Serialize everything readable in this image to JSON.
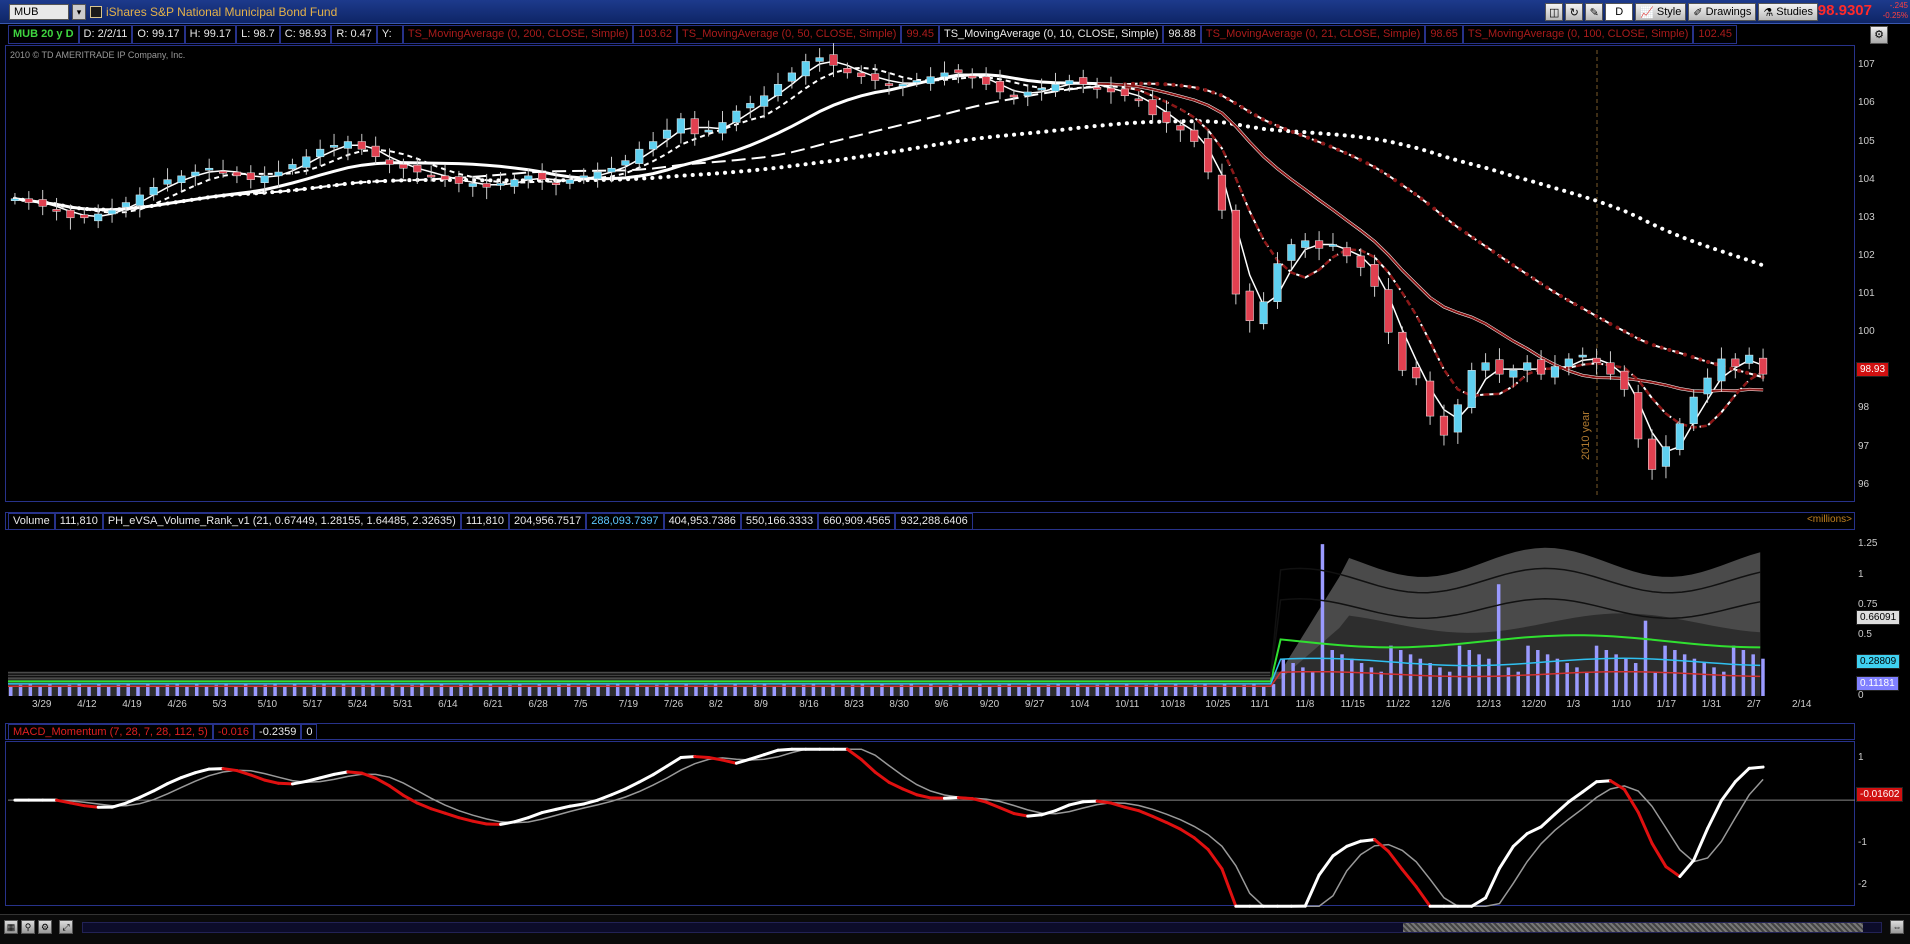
{
  "window": {
    "symbol": "MUB",
    "description": "iShares S&P National Municipal Bond Fund",
    "last_price": "98.9307",
    "change_1": "-.245",
    "change_2": "-0.25%",
    "buttons": {
      "period_label": "D",
      "style_label": "Style",
      "drawings_label": "Drawings",
      "studies_label": "Studies"
    }
  },
  "info": {
    "aggregation": "MUB 20 y D",
    "date": "D: 2/2/11",
    "open": "O: 99.17",
    "high": "H: 99.17",
    "low": "L: 98.7",
    "close": "C: 98.93",
    "range": "R: 0.47",
    "y": "Y:",
    "studies": [
      {
        "label": "TS_MovingAverage (0, 200, CLOSE, Simple)",
        "value": "103.62",
        "color": "red"
      },
      {
        "label": "TS_MovingAverage (0, 50, CLOSE, Simple)",
        "value": "99.45",
        "color": "red"
      },
      {
        "label": "TS_MovingAverage (0, 10, CLOSE, Simple)",
        "value": "98.88",
        "color": "white"
      },
      {
        "label": "TS_MovingAverage (0, 21, CLOSE, Simple)",
        "value": "98.65",
        "color": "red"
      },
      {
        "label": "TS_MovingAverage (0, 100, CLOSE, Simple)",
        "value": "102.45",
        "color": "red"
      }
    ]
  },
  "copyright": "2010 © TD AMERITRADE IP Company, Inc.",
  "price_axis": [
    "107",
    "106",
    "105",
    "104",
    "103",
    "102",
    "101",
    "100",
    "99",
    "98",
    "97",
    "96"
  ],
  "price_tag": "98.93",
  "year_marker": "2010 year",
  "volume": {
    "label": "Volume",
    "value": "111,810",
    "study_name": "PH_eVSA_Volume_Rank_v1 (21, 0.67449, 1.28155, 1.64485, 2.32635)",
    "study_values": [
      "111,810",
      "204,956.7517",
      "288,093.7397",
      "404,953.7386",
      "550,166.3333",
      "660,909.4565",
      "932,288.6406"
    ],
    "units": "<millions>",
    "axis": [
      "1.25",
      "1",
      "0.75",
      "0.5",
      "0.25",
      "0"
    ],
    "tags": {
      "gray": "0.66091",
      "cyan": "0.28809",
      "blue": "0.11181"
    }
  },
  "dates": [
    "3/29",
    "4/12",
    "4/19",
    "4/26",
    "5/3",
    "5/10",
    "5/17",
    "5/24",
    "5/31",
    "6/14",
    "6/21",
    "6/28",
    "7/5",
    "7/19",
    "7/26",
    "8/2",
    "8/9",
    "8/16",
    "8/23",
    "8/30",
    "9/6",
    "9/20",
    "9/27",
    "10/4",
    "10/11",
    "10/18",
    "10/25",
    "11/1",
    "11/8",
    "11/15",
    "11/22",
    "12/6",
    "12/13",
    "12/20",
    "1/3",
    "1/10",
    "1/17",
    "1/31",
    "2/7",
    "2/14"
  ],
  "macd": {
    "label": "MACD_Momentum (7, 28, 7, 28, 112, 5)",
    "v1": "-0.016",
    "v2": "-0.2359",
    "v3": "0",
    "axis": [
      "1",
      "0",
      "-1",
      "-2"
    ],
    "tag": "-0.01602"
  },
  "colors": {
    "up": "#5fd0f0",
    "down": "#e04050",
    "ma_red": "#9b1b1b",
    "accent": "#ff2a2a"
  },
  "chart_data": {
    "type": "candlestick",
    "ylim": [
      95.6,
      107.4
    ],
    "note_x": "weekly-ish samples of daily bars, Mar 2010 - Feb 2011",
    "close": [
      103.5,
      103.4,
      103.3,
      103.2,
      103.0,
      103.0,
      103.1,
      103.2,
      103.4,
      103.6,
      103.8,
      104.0,
      104.1,
      104.2,
      104.3,
      104.2,
      104.1,
      104.0,
      104.1,
      104.2,
      104.4,
      104.6,
      104.8,
      104.9,
      105.0,
      104.8,
      104.6,
      104.4,
      104.3,
      104.2,
      104.1,
      104.0,
      103.9,
      103.9,
      103.8,
      103.9,
      104.0,
      104.1,
      104.0,
      103.9,
      104.0,
      104.1,
      104.2,
      104.3,
      104.5,
      104.8,
      105.0,
      105.3,
      105.6,
      105.2,
      105.3,
      105.5,
      105.8,
      106.0,
      106.2,
      106.5,
      106.8,
      107.1,
      107.2,
      107.0,
      106.8,
      106.7,
      106.6,
      106.5,
      106.5,
      106.6,
      106.7,
      106.8,
      106.8,
      106.7,
      106.5,
      106.3,
      106.2,
      106.3,
      106.4,
      106.5,
      106.6,
      106.5,
      106.4,
      106.3,
      106.2,
      106.1,
      105.7,
      105.5,
      105.3,
      105.0,
      104.2,
      103.2,
      101.0,
      100.3,
      100.8,
      101.8,
      102.3,
      102.4,
      102.2,
      102.3,
      102.0,
      101.7,
      101.2,
      100.0,
      99.0,
      98.8,
      97.8,
      97.3,
      98.1,
      99.0,
      99.2,
      98.9,
      99.0,
      99.2,
      98.9,
      99.1,
      99.3,
      99.4,
      99.2,
      98.9,
      98.5,
      97.2,
      96.4,
      97.0,
      97.6,
      98.3,
      98.8,
      99.3,
      99.1,
      99.4,
      98.9
    ]
  }
}
